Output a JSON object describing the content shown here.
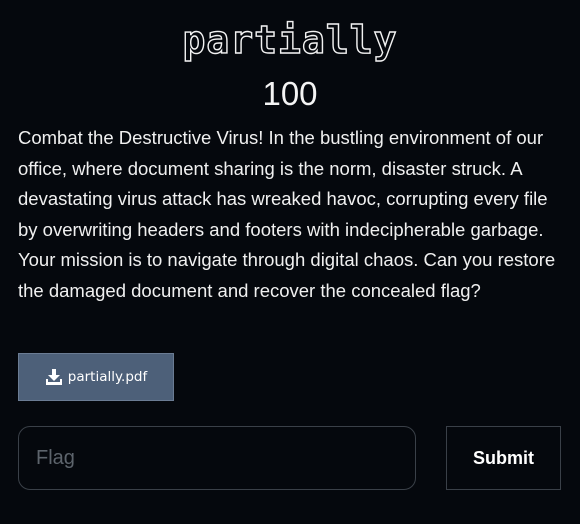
{
  "challenge": {
    "title": "partially",
    "points": "100",
    "description": "Combat the Destructive Virus! In the bustling environment of our office, where document sharing is the norm, disaster struck. A devastating virus attack has wreaked havoc, corrupting every file by overwriting headers and footers with indecipherable garbage. Your mission is to navigate through digital chaos. Can you restore the damaged document and recover the concealed flag?"
  },
  "attachment": {
    "icon": "download-icon",
    "filename": "partially.pdf"
  },
  "submission": {
    "input_placeholder": "Flag",
    "input_value": "",
    "submit_label": "Submit"
  },
  "colors": {
    "background": "#05080d",
    "download_button": "#4d6079",
    "border": "#3a4048"
  }
}
